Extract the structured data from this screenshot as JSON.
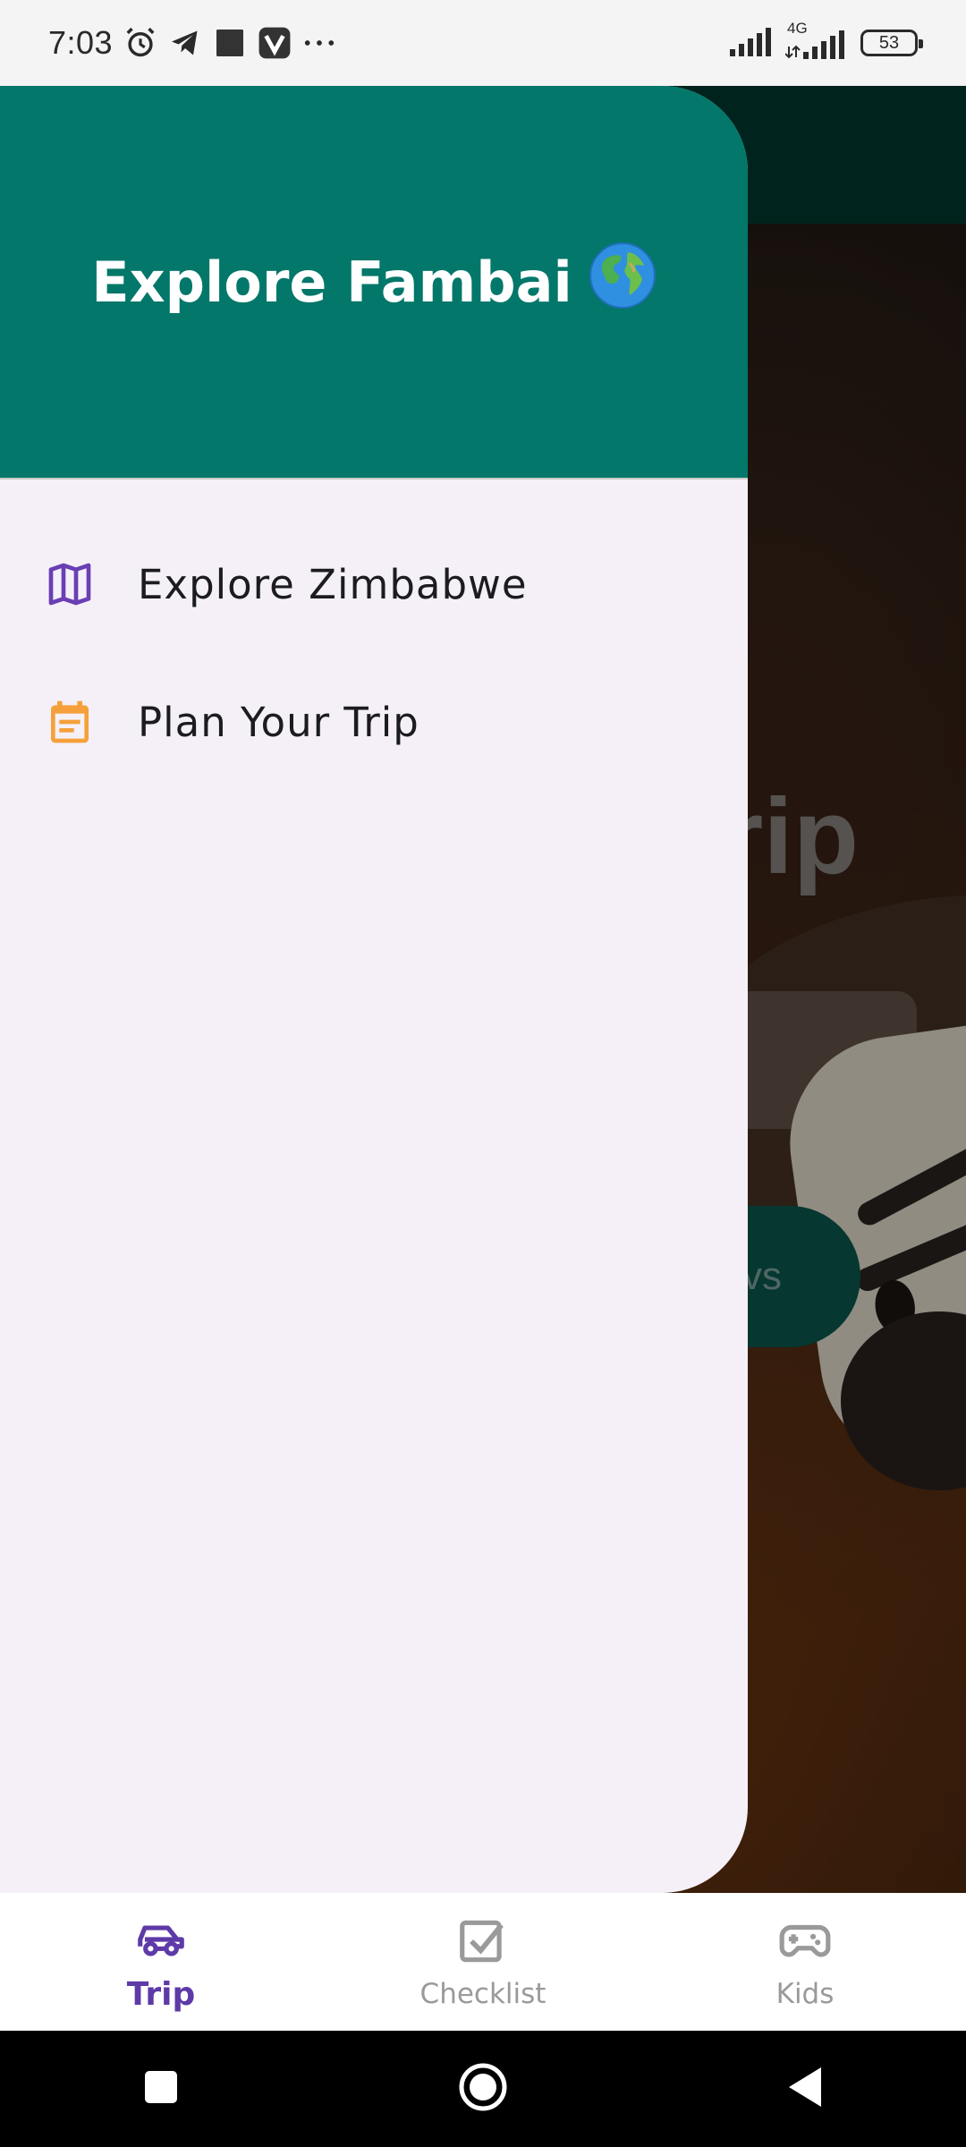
{
  "status_bar": {
    "time": "7:03",
    "battery_level": "53",
    "network_label": "4G",
    "icons": [
      "alarm-icon",
      "telegram-icon",
      "square-notification-icon",
      "v-app-icon",
      "more-dots-icon",
      "signal-icon",
      "signal-4g-icon",
      "battery-icon"
    ]
  },
  "drawer": {
    "title": "Explore Fambai",
    "title_emoji": "globe-icon",
    "header_color": "#02776a",
    "items": [
      {
        "label": "Explore Zimbabwe",
        "icon": "map-icon",
        "icon_color": "#6a3fb5"
      },
      {
        "label": "Plan Your Trip",
        "icon": "calendar-note-icon",
        "icon_color": "#f5a03a"
      }
    ]
  },
  "background_screen": {
    "title_fragment": "rip",
    "button_fragment": "vs"
  },
  "bottom_nav": {
    "items": [
      {
        "label": "Trip",
        "icon": "car-icon",
        "active": true
      },
      {
        "label": "Checklist",
        "icon": "checkbox-icon",
        "active": false
      },
      {
        "label": "Kids",
        "icon": "gamepad-icon",
        "active": false
      }
    ],
    "active_color": "#5e3aa8",
    "inactive_color": "#9a9a9a"
  },
  "system_nav": {
    "buttons": [
      "recents-icon",
      "home-icon",
      "back-icon"
    ]
  }
}
